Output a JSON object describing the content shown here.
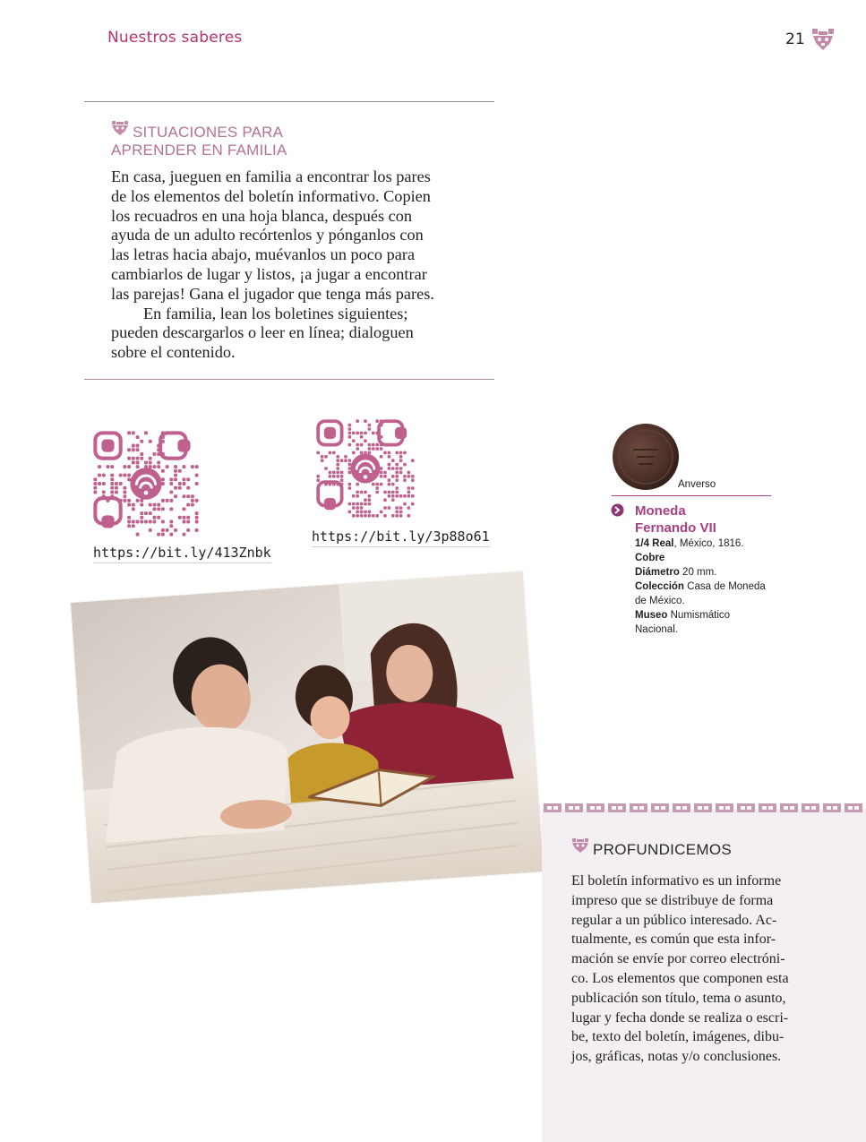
{
  "header": {
    "title": "Nuestros saberes",
    "page_number": "21",
    "logo_icon": "ornament-icon"
  },
  "situaciones": {
    "heading_line1": "SITUACIONES PARA",
    "heading_line2": "APRENDER EN FAMILIA",
    "lines": [
      "En casa, jueguen en familia a encontrar los pares",
      "de los elementos del boletín informativo. Copien",
      "los recuadros en una hoja blanca, después con",
      "ayuda de un adulto recórtenlos y pónganlos con",
      "las letras hacia abajo, muévanlos un poco para",
      "cambiarlos de lugar y listos, ¡a jugar a encontrar",
      "las parejas! Gana el jugador que tenga más pares."
    ],
    "lines2": [
      "En familia, lean los boletines siguientes;",
      "pueden descargarlos o leer en línea; dialoguen",
      "sobre el contenido."
    ]
  },
  "qr_codes": [
    {
      "link": "https://bit.ly/413Znbk"
    },
    {
      "link": "https://bit.ly/3p88o61"
    }
  ],
  "coin": {
    "caption": "Anverso",
    "title_line1": "Moneda",
    "title_line2": "Fernando VII",
    "value_label": "1/4 Real",
    "value_rest": ", México, 1816.",
    "metal": "Cobre",
    "diam_label": "Diámetro",
    "diam_value": " 20 mm.",
    "coleccion_label": "Colección",
    "coleccion_value": " Casa de Moneda",
    "coleccion_value2": "de México.",
    "museo_label": "Museo",
    "museo_value": " Numismático",
    "museo_value2": "Nacional."
  },
  "profundicemos": {
    "heading": "PROFUNDICEMOS",
    "lines": [
      "El boletín informativo es un informe",
      "impreso que se distribuye de forma",
      "regular a un público interesado. Ac-",
      "tualmente, es común que esta infor-",
      "mación se envíe por correo electróni-",
      "co. Los elementos que componen esta",
      "publicación son título, tema o asunto,",
      "lugar y fecha donde se realiza o escri-",
      "be, texto del boletín, imágenes, dibu-",
      "jos, gráficas, notas y/o conclusiones."
    ]
  },
  "colors": {
    "accent": "#b5326f",
    "heading": "#b27394",
    "qr": "#c0608f",
    "panel": "#f3eff2"
  }
}
